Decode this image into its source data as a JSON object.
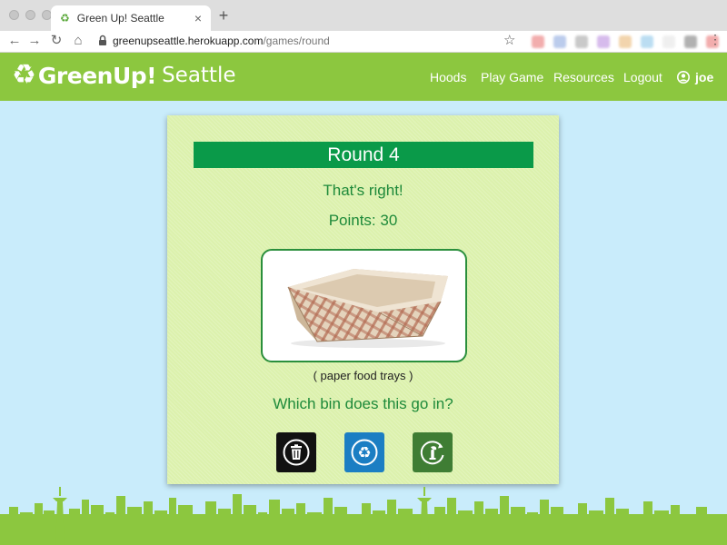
{
  "browser": {
    "tab_title": "Green Up! Seattle",
    "tab_close": "×",
    "new_tab": "+",
    "url_host": "greenupseattle.herokuapp.com",
    "url_path": "/games/round"
  },
  "header": {
    "logo_icon": "recycle-icon",
    "logo_brand": "GreenUp!",
    "logo_city": "Seattle",
    "nav": {
      "hoods": "Hoods",
      "play_game": "Play Game",
      "resources": "Resources",
      "logout": "Logout"
    },
    "user": "joe"
  },
  "game": {
    "round_label": "Round 4",
    "feedback": "That's right!",
    "points_label": "Points: 30",
    "item_caption": "( paper food trays )",
    "question": "Which bin does this go in?",
    "bins": [
      {
        "name": "trash",
        "icon": "trash-can-icon",
        "color": "#111111"
      },
      {
        "name": "recycle",
        "icon": "recycle-icon",
        "color": "#1b7ec3"
      },
      {
        "name": "compost",
        "icon": "compost-icon",
        "color": "#3f7d34"
      }
    ]
  },
  "colors": {
    "header_green": "#8cc73f",
    "round_bar": "#0a9a49",
    "text_green": "#1e8a3a",
    "page_background": "#c9ecfb",
    "card_background": "#dcf1ad"
  }
}
